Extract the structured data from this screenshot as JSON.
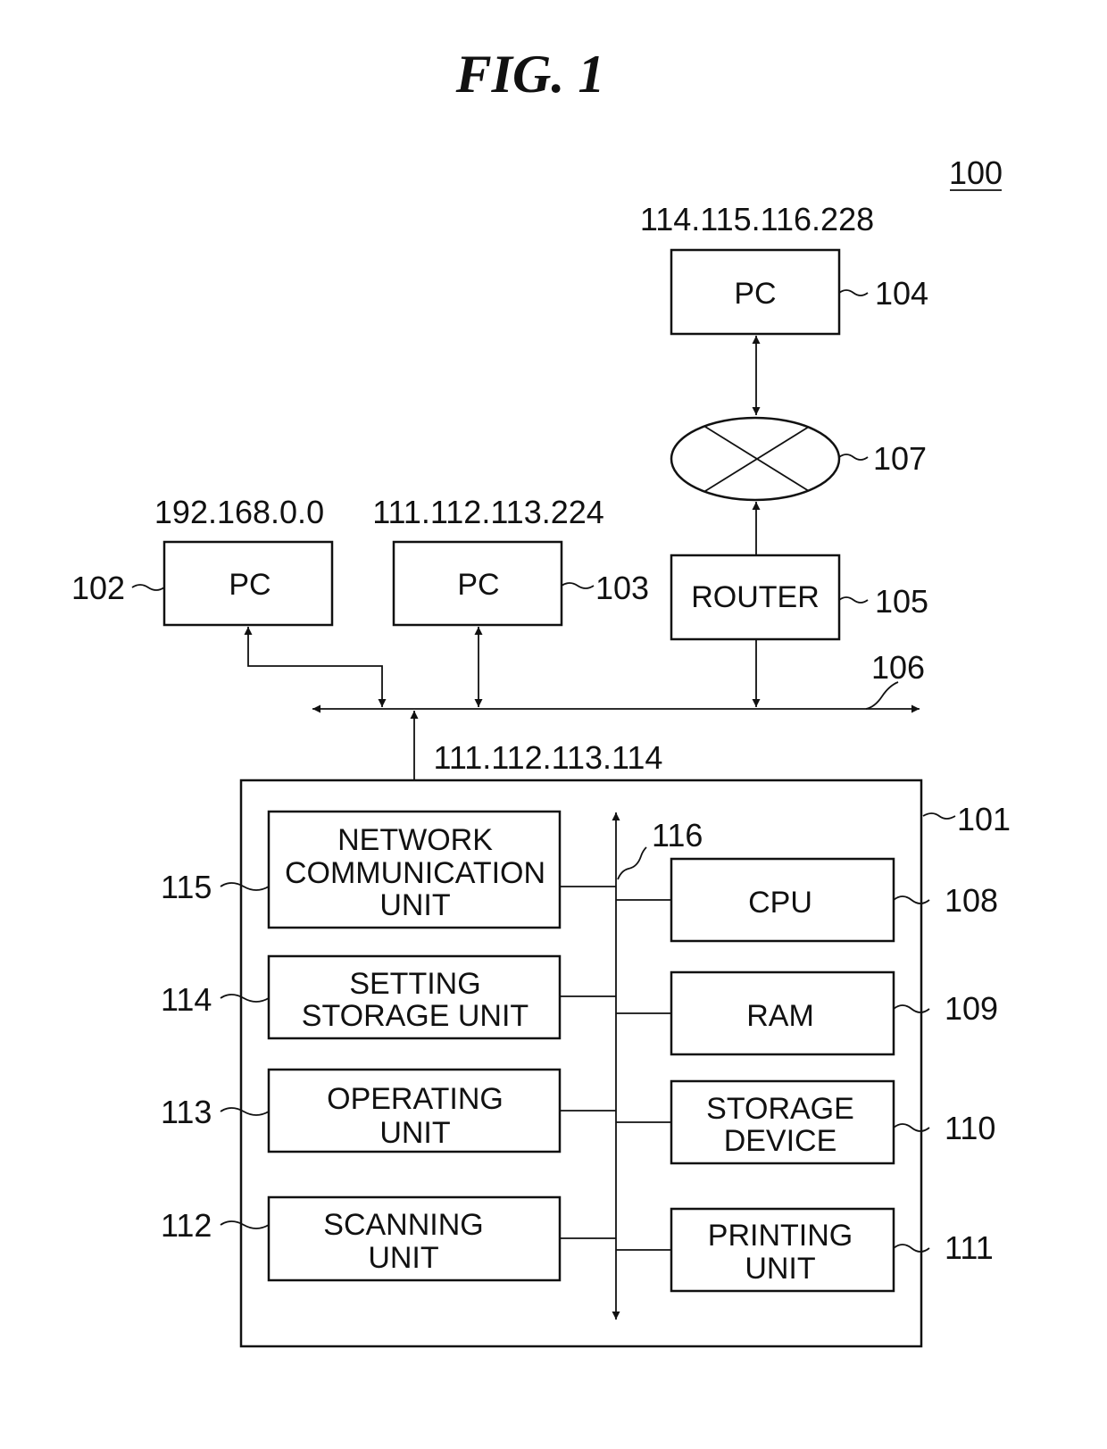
{
  "figure": {
    "title": "FIG. 1",
    "system_ref": "100"
  },
  "network": {
    "bus_ref": "106",
    "internet_ref": "107",
    "nodes": {
      "pc102": {
        "label": "PC",
        "ref": "102",
        "ip": "192.168.0.0"
      },
      "pc103": {
        "label": "PC",
        "ref": "103",
        "ip": "111.112.113.224"
      },
      "pc104": {
        "label": "PC",
        "ref": "104",
        "ip": "114.115.116.228"
      },
      "router": {
        "label": "ROUTER",
        "ref": "105"
      }
    }
  },
  "device": {
    "ref": "101",
    "ip": "111.112.113.114",
    "internal_bus_ref": "116",
    "left_units": [
      {
        "lines": [
          "NETWORK",
          "COMMUNICATION",
          "UNIT"
        ],
        "ref": "115"
      },
      {
        "lines": [
          "SETTING",
          "STORAGE UNIT"
        ],
        "ref": "114"
      },
      {
        "lines": [
          "OPERATING",
          "UNIT"
        ],
        "ref": "113"
      },
      {
        "lines": [
          "SCANNING",
          "UNIT"
        ],
        "ref": "112"
      }
    ],
    "right_units": [
      {
        "lines": [
          "CPU"
        ],
        "ref": "108"
      },
      {
        "lines": [
          "RAM"
        ],
        "ref": "109"
      },
      {
        "lines": [
          "STORAGE",
          "DEVICE"
        ],
        "ref": "110"
      },
      {
        "lines": [
          "PRINTING",
          "UNIT"
        ],
        "ref": "111"
      }
    ]
  }
}
